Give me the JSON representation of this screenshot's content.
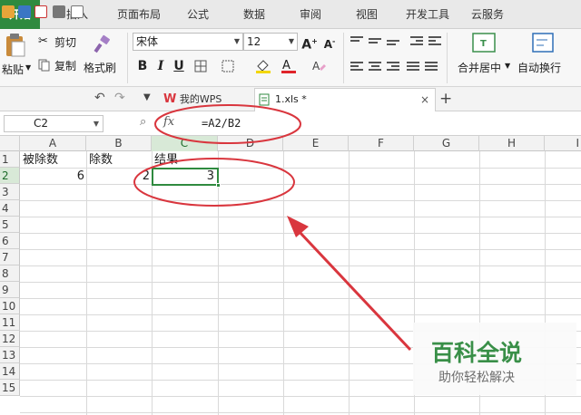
{
  "menu_tabs": [
    "开始",
    "插入",
    "页面布局",
    "公式",
    "数据",
    "审阅",
    "视图",
    "开发工具",
    "云服务"
  ],
  "ribbon": {
    "paste_label": "粘贴",
    "cut_label": "剪切",
    "copy_label": "复制",
    "format_painter_label": "格式刷",
    "font_name": "宋体",
    "font_size": "12",
    "merge_label": "合并居中",
    "wrap_label": "自动换行"
  },
  "document_tabs": {
    "wps_tab": "我的WPS",
    "file_tab": "1.xls *",
    "new_tab": "+"
  },
  "formula_bar": {
    "name_box": "C2",
    "fx_label": "fx",
    "formula": "=A2/B2"
  },
  "columns": [
    "A",
    "B",
    "C",
    "D",
    "E",
    "F",
    "G",
    "H",
    "I"
  ],
  "rows": [
    "1",
    "2",
    "3",
    "4",
    "5",
    "6",
    "7",
    "8",
    "9",
    "10",
    "11",
    "12",
    "13",
    "14",
    "15"
  ],
  "cells": {
    "A1": "被除数",
    "B1": "除数",
    "C1": "结果",
    "A2": "6",
    "B2": "2",
    "C2": "3"
  },
  "watermark": {
    "title": "百科全说",
    "subtitle": "助你轻松解决"
  },
  "colors": {
    "accent_green": "#2f8a3f",
    "annotation_red": "#d9363e"
  }
}
